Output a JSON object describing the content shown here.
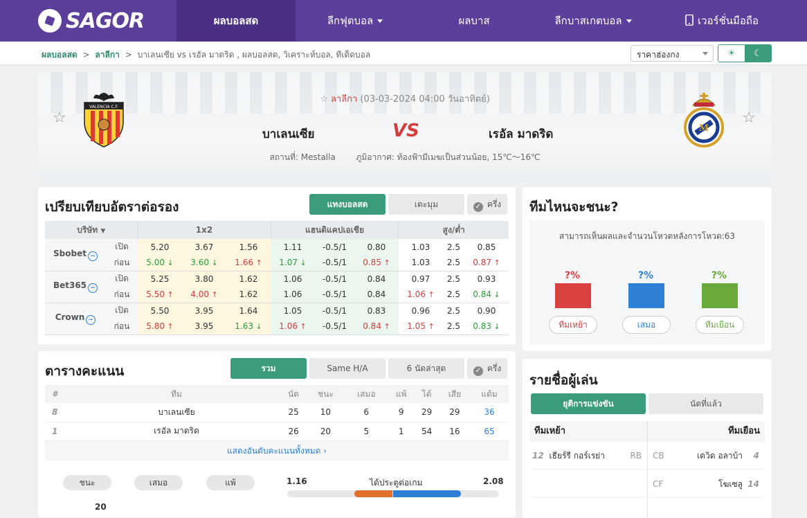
{
  "brand": {
    "name": "SAGOR"
  },
  "nav": {
    "items": [
      {
        "label": "ผลบอลสด",
        "active": true
      },
      {
        "label": "ลีกฟุตบอล",
        "dropdown": true
      },
      {
        "label": "ผลบาส"
      },
      {
        "label": "ลีกบาสเกตบอล",
        "dropdown": true
      },
      {
        "label": "เวอร์ชั่นมือถือ"
      }
    ]
  },
  "breadcrumb": {
    "home": "ผลบอลสด",
    "sep": ">",
    "league": "ลาลีกา",
    "current": "บาเลนเซีย vs  เรอัล มาดริด ,  ผลบอลสด,  วิเคราะห์บอล,  ทีเด็ดบอล"
  },
  "odds_select": {
    "value": "ราคาฮ่องกง"
  },
  "match": {
    "league": "ลาลีกา",
    "datetime": "(03-03-2024 04:00 วันอาทิตย์)",
    "home": "บาเลนเซีย",
    "away": "เรอัล มาดริด",
    "vs": "VS",
    "venue": "สถานที่: Mestalla",
    "weather": "ภูมิอากาศ: ท้องฟ้ามีเมฆเป็นส่วนน้อย, 15℃～16℃",
    "home_crest_text": "VALENCIA C.F."
  },
  "odds": {
    "title": "เปรียบเทียบอัตราต่อรอง",
    "tabs": [
      "แทงบอลสด",
      "เตะมุม",
      "ครึ่ง"
    ],
    "headers": [
      "บริษัท",
      "1x2",
      "แฮนดิแคปเอเชีย",
      "สูง/ต่ำ"
    ],
    "rows": [
      {
        "book": "Sbobet",
        "open": [
          "5.20",
          "3.67",
          "1.56",
          "1.11",
          "-0.5/1",
          "0.80",
          "1.03",
          "2.5",
          "0.85"
        ],
        "live": [
          "5.00",
          "3.60",
          "1.66",
          "1.07",
          "-0.5/1",
          "0.85",
          "1.03",
          "2.5",
          "0.87"
        ],
        "live_dir": [
          "dn",
          "dn",
          "up",
          "dn",
          "",
          "up",
          "",
          "",
          "up"
        ]
      },
      {
        "book": "Bet365",
        "open": [
          "5.25",
          "3.80",
          "1.62",
          "1.06",
          "-0.5/1",
          "0.84",
          "0.97",
          "2.5",
          "0.93"
        ],
        "live": [
          "5.50",
          "4.00",
          "1.62",
          "1.06",
          "-0.5/1",
          "0.84",
          "1.06",
          "2.5",
          "0.84"
        ],
        "live_dir": [
          "up",
          "up",
          "",
          "",
          "",
          "",
          "up",
          "",
          "dn"
        ]
      },
      {
        "book": "Crown",
        "open": [
          "5.50",
          "3.95",
          "1.64",
          "1.05",
          "-0.5/1",
          "0.83",
          "0.96",
          "2.5",
          "0.90"
        ],
        "live": [
          "5.80",
          "3.95",
          "1.63",
          "1.06",
          "-0.5/1",
          "0.84",
          "1.05",
          "2.5",
          "0.83"
        ],
        "live_dir": [
          "up",
          "",
          "dn",
          "up",
          "",
          "up",
          "up",
          "",
          "dn"
        ]
      }
    ],
    "open_label": "เปิด",
    "live_label": "ก่อน"
  },
  "standings": {
    "title": "ตารางคะแนน",
    "tabs": [
      "รวม",
      "Same H/A",
      "6 นัดล่าสุด",
      "ครึ่ง"
    ],
    "headers": [
      "#",
      "ทีม",
      "นัด",
      "ชนะ",
      "เสมอ",
      "แพ้",
      "ได้",
      "เสีย",
      "แต้ม"
    ],
    "rows": [
      [
        "8",
        "บาเลนเซีย",
        "25",
        "10",
        "6",
        "9",
        "29",
        "29",
        "36"
      ],
      [
        "1",
        "เรอัล มาดริด",
        "26",
        "20",
        "5",
        "1",
        "54",
        "16",
        "65"
      ]
    ],
    "show_all": "แสดงอันดับคะแนนทั้งหมด",
    "pills": [
      "ชนะ",
      "เสมอ",
      "แพ้"
    ],
    "goals_label": "ได้ประตูต่อเกม",
    "goals_home": "1.16",
    "goals_away": "2.08",
    "partial_value": "20"
  },
  "predict": {
    "title": "ทีมไหนจะชนะ?",
    "votes_text": "สามารถเห็นผลและจำนวนโหวตหลังการโหวต:63",
    "options": [
      {
        "pct": "?%",
        "label": "ทีมเหย้า",
        "color": "#d94040"
      },
      {
        "pct": "?%",
        "label": "เสมอ",
        "color": "#2e7fd6"
      },
      {
        "pct": "?%",
        "label": "ทีมเยือน",
        "color": "#6aaa3c"
      }
    ]
  },
  "lineup": {
    "title": "รายชื่อผู้เล่น",
    "tabs": [
      "ยุติการแข่งขัน",
      "นัดที่แล้ว"
    ],
    "home_header": "ทีมเหย้า",
    "away_header": "ทีมเยือน",
    "home": [
      {
        "num": "12",
        "name": "เธียร์รี กอร์เรย่า",
        "pos": "RB"
      }
    ],
    "away": [
      {
        "num": "4",
        "name": "เดวิด อลาบ้า",
        "pos": "CB"
      },
      {
        "num": "14",
        "name": "โฆเซลู",
        "pos": "CF"
      }
    ]
  }
}
